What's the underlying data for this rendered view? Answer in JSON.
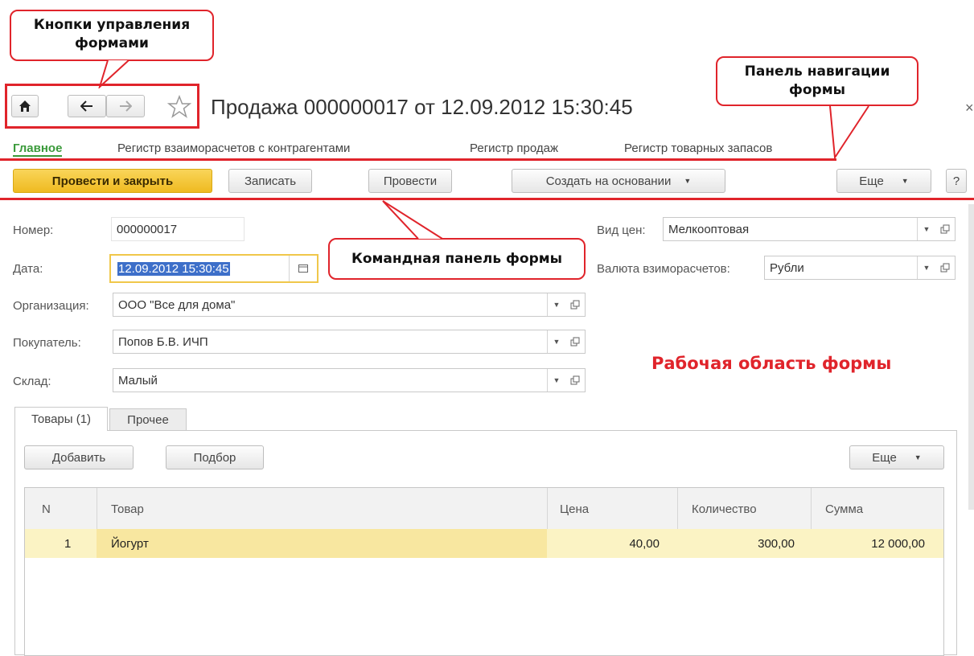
{
  "annotations": {
    "form_buttons_callout_line1": "Кнопки управления",
    "form_buttons_callout_line2": "формами",
    "nav_panel_callout_line1": "Панель навигации",
    "nav_panel_callout_line2": "формы",
    "command_panel_callout": "Командная панель формы",
    "work_area_label": "Рабочая область формы"
  },
  "window": {
    "title": "Продажа 000000017 от 12.09.2012 15:30:45",
    "close_glyph": "×"
  },
  "nav_tabs": [
    {
      "label": "Главное",
      "active": true
    },
    {
      "label": "Регистр взаиморасчетов с контрагентами",
      "active": false
    },
    {
      "label": "Регистр продаж",
      "active": false
    },
    {
      "label": "Регистр товарных запасов",
      "active": false
    }
  ],
  "toolbar": {
    "post_and_close": "Провести и закрыть",
    "save": "Записать",
    "post": "Провести",
    "create_based_on": "Создать на основании",
    "more": "Еще",
    "help": "?"
  },
  "form": {
    "number_label": "Номер:",
    "number_value": "000000017",
    "date_label": "Дата:",
    "date_value": "12.09.2012 15:30:45",
    "org_label": "Организация:",
    "org_value": "ООО \"Все для дома\"",
    "buyer_label": "Покупатель:",
    "buyer_value": "Попов Б.В. ИЧП",
    "warehouse_label": "Склад:",
    "warehouse_value": "Малый",
    "price_type_label": "Вид цен:",
    "price_type_value": "Мелкооптовая",
    "currency_label": "Валюта взиморасчетов:",
    "currency_value": "Рубли"
  },
  "tabs": [
    {
      "label": "Товары (1)",
      "active": true
    },
    {
      "label": "Прочее",
      "active": false
    }
  ],
  "table_toolbar": {
    "add": "Добавить",
    "pick": "Подбор",
    "more": "Еще"
  },
  "table": {
    "columns": [
      "N",
      "Товар",
      "Цена",
      "Количество",
      "Сумма"
    ],
    "rows": [
      {
        "n": "1",
        "product": "Йогурт",
        "price": "40,00",
        "qty": "300,00",
        "sum": "12 000,00"
      }
    ]
  },
  "colors": {
    "accent_red": "#e0242b",
    "primary_button": "#f4c431",
    "active_tab": "#3a9a3a",
    "selected_row": "#fbf0b0"
  }
}
